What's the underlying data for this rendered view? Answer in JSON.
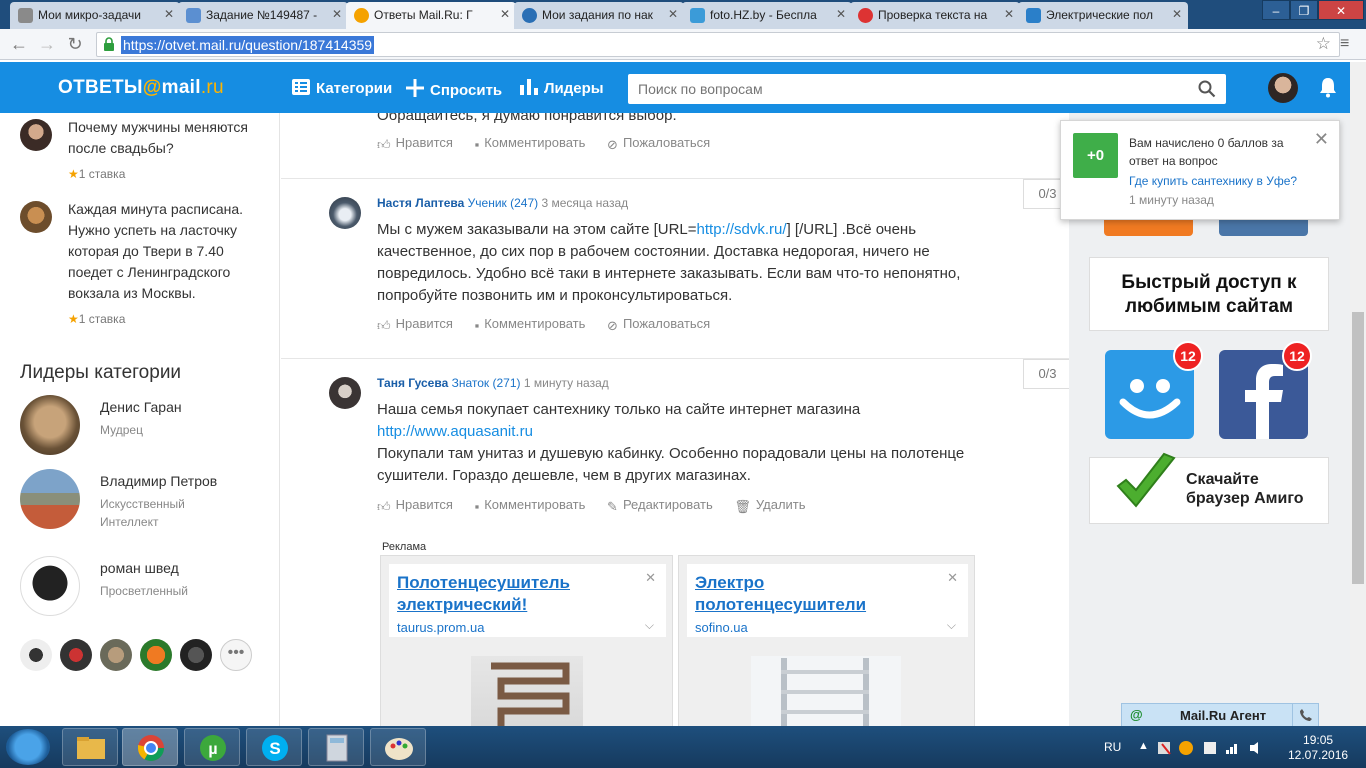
{
  "browser": {
    "tabs": [
      {
        "title": "Мои микро-задачи",
        "active": false
      },
      {
        "title": "Задание №149487 -",
        "active": false
      },
      {
        "title": "Ответы Mail.Ru: Г",
        "active": true
      },
      {
        "title": "Мои задания по нак",
        "active": false
      },
      {
        "title": "foto.HZ.by - Беспла",
        "active": false
      },
      {
        "title": "Проверка текста на",
        "active": false
      },
      {
        "title": "Электрические пол",
        "active": false
      }
    ],
    "url": "https://otvet.mail.ru/question/187414359"
  },
  "header": {
    "logo_main": "ОТВЕТЫ",
    "logo_at": "@",
    "logo_mail": "mail",
    "logo_dot_ru": ".ru",
    "nav": {
      "categories": "Категории",
      "ask": "Спросить",
      "leaders": "Лидеры"
    },
    "search_placeholder": "Поиск по вопросам"
  },
  "sidebar": {
    "questions": [
      {
        "text": "Почему мужчины меняются после свадьбы?",
        "stake": "1 ставка"
      },
      {
        "text": "Каждая минута расписана. Нужно успеть на ласточку которая до Твери в 7.40 поедет с Ленинградского вокзала из Москвы.",
        "stake": "1 ставка"
      }
    ],
    "leaders_title": "Лидеры категории",
    "leaders": [
      {
        "name": "Денис Гаран",
        "rank": "Мудрец"
      },
      {
        "name": "Владимир Петров",
        "rank": "Искусственный Интеллект"
      },
      {
        "name": "роман швед",
        "rank": "Просветленный"
      }
    ],
    "more": "•••"
  },
  "answers": [
    {
      "text_tail": "Обращайтесь, я думаю понравится выбор.",
      "actions": {
        "like": "Нравится",
        "comment": "Комментировать",
        "complain": "Пожаловаться"
      }
    },
    {
      "author": "Настя Лаптева",
      "rank": "Ученик (247)",
      "time": "3 месяца назад",
      "score": "0/3",
      "text_a": "Мы с мужем заказывали на этом сайте [URL=",
      "link": "http://sdvk.ru/",
      "text_b": "] [/URL] .Всё очень качественное, до сих пор в рабочем состоянии. Доставка недорогая, ничего не повредилось. Удобно всё таки в интернете заказывать. Если вам что-то непонятно, попробуйте позвонить им и проконсультироваться.",
      "actions": {
        "like": "Нравится",
        "comment": "Комментировать",
        "complain": "Пожаловаться"
      }
    },
    {
      "author": "Таня Гусева",
      "rank": "Знаток (271)",
      "time": "1 минуту назад",
      "score": "0/3",
      "text_a": "Наша семья покупает сантехнику только на сайте интернет магазина",
      "link": "http://www.aquasanit.ru",
      "text_b": "Покупали там унитаз и душевую кабинку. Особенно порадовали цены на полотенце сушители. Гораздо дешевле, чем в других магазинах.",
      "actions": {
        "like": "Нравится",
        "comment": "Комментировать",
        "edit": "Редактировать",
        "delete": "Удалить"
      }
    }
  ],
  "ads": {
    "label": "Реклама",
    "items": [
      {
        "title": "Полотенцесушитель электрический!",
        "domain": "taurus.prom.ua"
      },
      {
        "title": "Электро полотенцесушители",
        "domain": "sofino.ua"
      }
    ]
  },
  "right": {
    "promo_text": "Быстрый доступ к любимым сайтам",
    "badge_count": "12",
    "amigo_text": "Скачайте браузер Амиго"
  },
  "notification": {
    "points": "+0",
    "text": "Вам начислено 0 баллов за ответ на вопрос",
    "link": "Где купить сантехнику в Уфе?",
    "time": "1 минуту назад"
  },
  "agent": {
    "icon": "@",
    "label": "Mail.Ru Агент"
  },
  "taskbar": {
    "lang": "RU",
    "time": "19:05",
    "date": "12.07.2016"
  }
}
